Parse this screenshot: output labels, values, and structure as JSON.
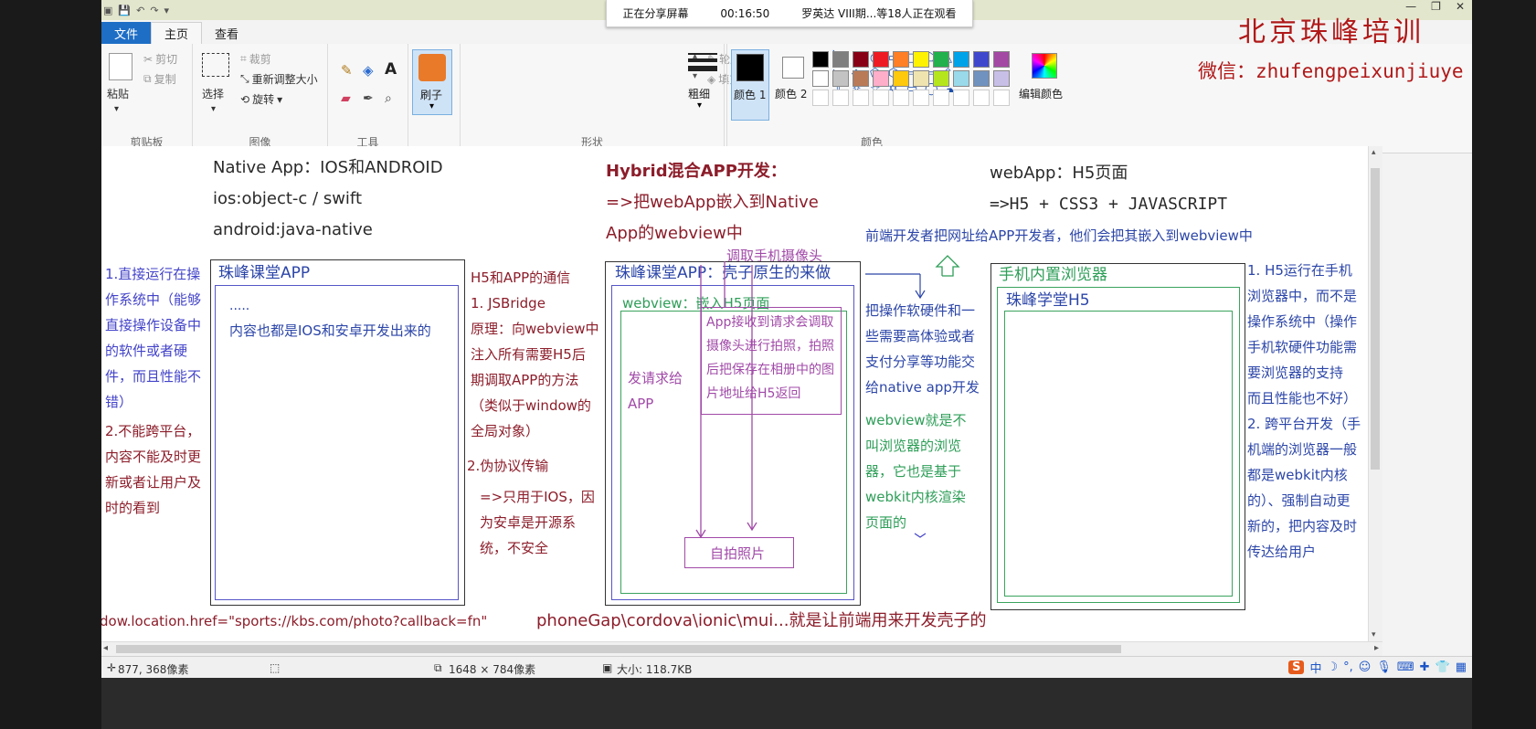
{
  "titlebar": {
    "share_status": "正在分享屏幕",
    "share_time": "00:16:50",
    "share_viewers": "罗英达 VIII期...等18人正在观看",
    "min": "—",
    "max": "❐",
    "close": "✕"
  },
  "tabs": {
    "file": "文件",
    "home": "主页",
    "view": "查看"
  },
  "ribbon": {
    "clipboard": {
      "paste": "粘贴",
      "cut": "剪切",
      "copy": "复制",
      "label": "剪贴板"
    },
    "image": {
      "select": "选择",
      "crop": "裁剪",
      "resize": "重新调整大小",
      "rotate": "旋转",
      "label": "图像"
    },
    "tools": {
      "label": "工具"
    },
    "brush": {
      "label": "刷子"
    },
    "shapes": {
      "outline": "轮廓",
      "fill": "填充",
      "label": "形状"
    },
    "size": {
      "label": "粗细"
    },
    "colors": {
      "color1": "颜色 1",
      "color2": "颜色 2",
      "edit": "编辑颜色",
      "label": "颜色",
      "palette": [
        "#000000",
        "#7f7f7f",
        "#880015",
        "#ed1c24",
        "#ff7f27",
        "#fff200",
        "#22b14c",
        "#00a2e8",
        "#3f48cc",
        "#a349a4",
        "#ffffff",
        "#c3c3c3",
        "#b97a57",
        "#ffaec9",
        "#ffc90e",
        "#efe4b0",
        "#b5e61d",
        "#99d9ea",
        "#7092be",
        "#c8bfe7"
      ]
    }
  },
  "brand": {
    "title": "北京珠峰培训",
    "wechat": "微信：zhufengpeixunjiuye"
  },
  "canvas": {
    "native_title": "Native App：IOS和ANDROID",
    "native_ios": "ios:object-c / swift",
    "native_android": "android:java-native",
    "native_app_box": "珠峰课堂APP",
    "native_dots": ".....",
    "native_content": "内容也都是IOS和安卓开发出来的",
    "left_blue_1": "1.直接运行在操",
    "left_blue_2": "作系统中（能够",
    "left_blue_3": "直接操作设备中",
    "left_blue_4": "的软件或者硬",
    "left_blue_5": "件，而且性能不",
    "left_blue_6": "错）",
    "left_red_1": "2.不能跨平台，",
    "left_red_2": "内容不能及时更",
    "left_red_3": "新或者让用户及",
    "left_red_4": "时的看到",
    "bridge_title": "H5和APP的通信",
    "bridge_1": "1. JSBridge",
    "bridge_2": "原理：向webview中",
    "bridge_3": "注入所有需要H5后",
    "bridge_4": "期调取APP的方法",
    "bridge_5": "（类似于window的",
    "bridge_6": "全局对象）",
    "pseudo_title": "2.伪协议传输",
    "pseudo_1": "=>只用于IOS，因",
    "pseudo_2": "为安卓是开源系",
    "pseudo_3": "统，不安全",
    "hybrid_title": "Hybrid混合APP开发：",
    "hybrid_1": "=>把webApp嵌入到Native",
    "hybrid_2": "App的webview中",
    "camera_label": "调取手机摄像头",
    "hybrid_box": "珠峰课堂APP：壳子原生的来做",
    "webview_label": "webview：嵌入H5页面",
    "request_1": "发请求给",
    "request_2": "APP",
    "app_recv_1": "App接收到请求会调取",
    "app_recv_2": "摄像头进行拍照，拍照",
    "app_recv_3": "后把保存在相册中的图",
    "app_recv_4": "片地址给H5返回",
    "selfie": "自拍照片",
    "webapp_title": "webApp：H5页面",
    "webapp_tech": "=>H5 + CSS3 + JAVASCRIPT",
    "frontend_note": "前端开发者把网址给APP开发者，他们会把其嵌入到webview中",
    "hw_1": "把操作软硬件和一",
    "hw_2": "些需要高体验或者",
    "hw_3": "支付分享等功能交",
    "hw_4": "给native app开发",
    "wv_1": "webview就是不",
    "wv_2": "叫浏览器的浏览",
    "wv_3": "器，它也是基于",
    "wv_4": "webkit内核渲染",
    "wv_5": "页面的",
    "browser_box": "手机内置浏览器",
    "h5_box": "珠峰学堂H5",
    "right_1": "1. H5运行在手机",
    "right_2": "浏览器中，而不是",
    "right_3": "操作系统中（操作",
    "right_4": "手机软硬件功能需",
    "right_5": "要浏览器的支持",
    "right_6": "而且性能也不好）",
    "right_7": "2. 跨平台开发（手",
    "right_8": "机端的浏览器一般",
    "right_9": "都是webkit内核",
    "right_10": "的）、强制自动更",
    "right_11": "新的，把内容及时",
    "right_12": "传达给用户",
    "location_code": "dow.location.href=\"sports://kbs.com/photo?callback=fn\"",
    "phonegap": "phoneGap\\cordova\\ionic\\mui...就是让前端用来开发壳子的"
  },
  "status": {
    "cursor": "877, 368像素",
    "dimensions": "1648 × 784像素",
    "size": "大小: 118.7KB"
  },
  "ime": {
    "logo": "S",
    "mode": "中"
  }
}
